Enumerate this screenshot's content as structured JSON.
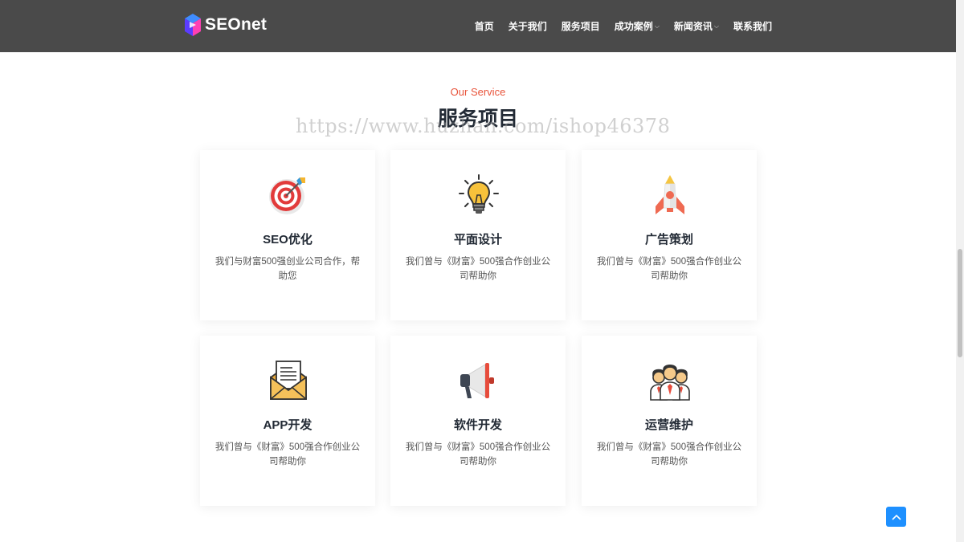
{
  "header": {
    "logo_text": "SEOnet",
    "nav": [
      {
        "label": "首页",
        "dropdown": false
      },
      {
        "label": "关于我们",
        "dropdown": false
      },
      {
        "label": "服务项目",
        "dropdown": false
      },
      {
        "label": "成功案例",
        "dropdown": true
      },
      {
        "label": "新闻资讯",
        "dropdown": true
      },
      {
        "label": "联系我们",
        "dropdown": false
      }
    ],
    "caret_glyph": "⌵"
  },
  "section": {
    "subtitle": "Our Service",
    "title": "服务项目",
    "watermark": "https://www.huzhan.com/ishop46378"
  },
  "services": [
    {
      "title": "SEO优化",
      "desc": "我们与财富500强创业公司合作，帮助您",
      "icon": "target-icon"
    },
    {
      "title": "平面设计",
      "desc": "我们曾与《财富》500强合作创业公司帮助你",
      "icon": "lightbulb-icon"
    },
    {
      "title": "广告策划",
      "desc": "我们曾与《财富》500强合作创业公司帮助你",
      "icon": "rocket-icon"
    },
    {
      "title": "APP开发",
      "desc": "我们曾与《财富》500强合作创业公司帮助你",
      "icon": "envelope-icon"
    },
    {
      "title": "软件开发",
      "desc": "我们曾与《财富》500强合作创业公司帮助你",
      "icon": "megaphone-icon"
    },
    {
      "title": "运营维护",
      "desc": "我们曾与《财富》500强合作创业公司帮助你",
      "icon": "team-icon"
    }
  ],
  "colors": {
    "header_bg": "#4a4a4a",
    "accent": "#e8533a",
    "title": "#222a35",
    "to_top": "#1e90ff"
  }
}
